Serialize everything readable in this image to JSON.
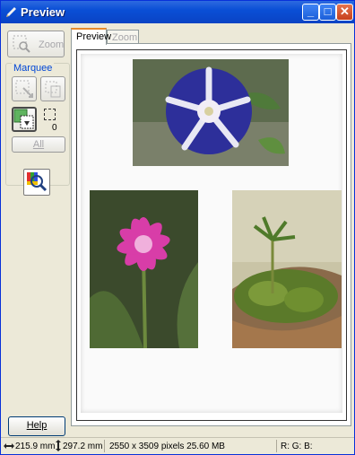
{
  "window": {
    "title": "Preview"
  },
  "titlebar_buttons": {
    "minimize": "_",
    "maximize": "□",
    "close": "✕"
  },
  "left_panel": {
    "zoom_label": "Zoom",
    "marquee_label": "Marquee",
    "marquee_count": "0",
    "all_label": "All",
    "help_label": "Help"
  },
  "tabs": [
    {
      "label": "Preview",
      "active": true
    },
    {
      "label": "Zoom",
      "active": false
    }
  ],
  "status": {
    "width": "215.9 mm",
    "height": "297.2 mm",
    "size_info": "2550 x 3509 pixels 25.60 MB",
    "rgb": "R:  G:  B:"
  },
  "colors": {
    "title_bar": "#0a4fd6",
    "tab_accent": "#e68b2c",
    "marquee_label": "#0046d5"
  },
  "icons": [
    "preview-app-icon",
    "zoom-icon",
    "marquee-add-icon",
    "marquee-remove-icon",
    "auto-locate-icon",
    "histogram-icon",
    "width-arrow-icon",
    "height-arrow-icon"
  ]
}
